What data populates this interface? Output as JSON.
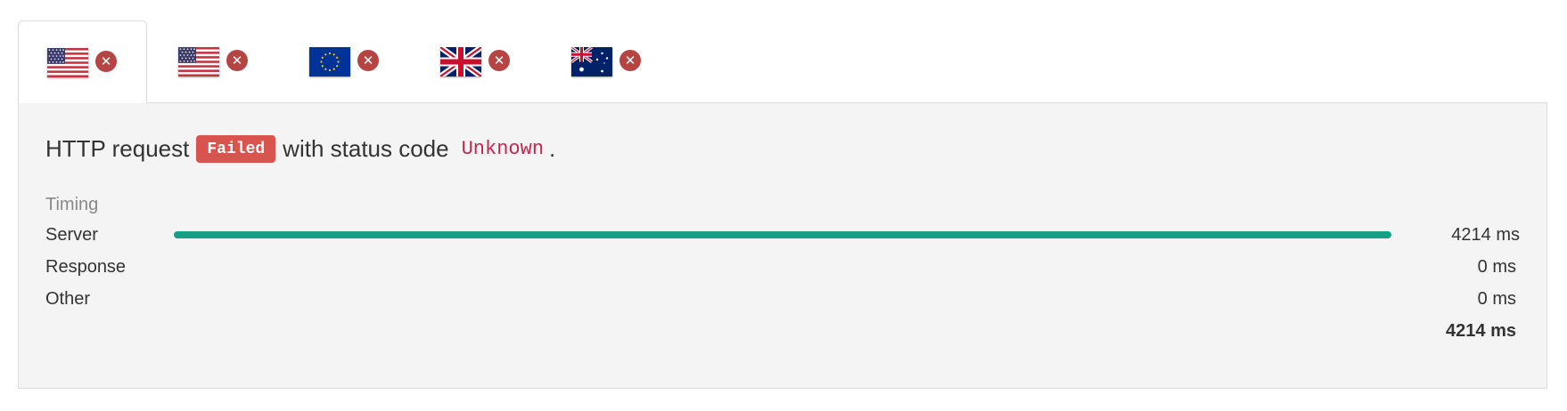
{
  "tabs": [
    {
      "flag": "us-flag-icon",
      "remove_icon": "close-circle-icon",
      "remove_glyph": "✕",
      "active": true
    },
    {
      "flag": "us-flag-icon",
      "remove_icon": "close-circle-icon",
      "remove_glyph": "✕",
      "active": false
    },
    {
      "flag": "eu-flag-icon",
      "remove_icon": "close-circle-icon",
      "remove_glyph": "✕",
      "active": false
    },
    {
      "flag": "uk-flag-icon",
      "remove_icon": "close-circle-icon",
      "remove_glyph": "✕",
      "active": false
    },
    {
      "flag": "au-flag-icon",
      "remove_icon": "close-circle-icon",
      "remove_glyph": "✕",
      "active": false
    }
  ],
  "result": {
    "prefix": "HTTP request",
    "status_badge": "Failed",
    "middle": "with status code",
    "status_code": "Unknown",
    "suffix": "."
  },
  "timing": {
    "title": "Timing",
    "rows": [
      {
        "label": "Server",
        "value": "4214 ms",
        "fraction": 1.0
      },
      {
        "label": "Response",
        "value": "0 ms",
        "fraction": 0
      },
      {
        "label": "Other",
        "value": "0 ms",
        "fraction": 0
      }
    ],
    "total": "4214 ms"
  },
  "colors": {
    "bar": "#16a085",
    "badge": "#d9534f",
    "remove": "#b54443",
    "code": "#c7254e"
  }
}
